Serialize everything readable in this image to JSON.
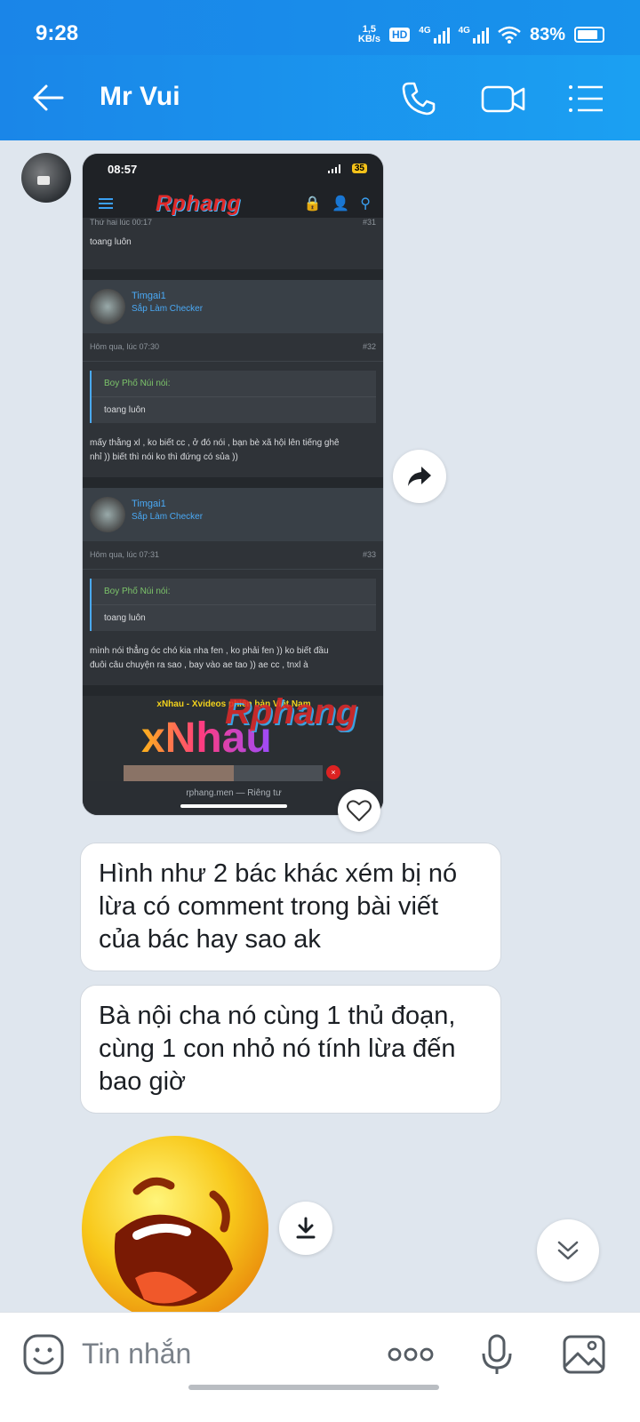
{
  "status_bar": {
    "time": "9:28",
    "net_speed_value": "1,5",
    "net_speed_unit": "KB/s",
    "hd": "HD",
    "sim1": "4G",
    "sim2": "4G",
    "battery": "83%"
  },
  "header": {
    "title": "Mr Vui",
    "icons": [
      "back-arrow-icon",
      "phone-icon",
      "video-camera-icon",
      "menu-list-icon"
    ]
  },
  "screenshot": {
    "time": "08:57",
    "battery": "35",
    "logo": "Rphang",
    "partial_meta": "Thứ hai lúc 00:17",
    "partial_num": "#31",
    "partial_text": "toang luôn",
    "posts": [
      {
        "user": "Timgai1",
        "badge": "Sắp Làm Checker",
        "meta": "Hôm qua, lúc 07:30",
        "num": "#32",
        "quote_author": "Boy Phố Núi nói:",
        "quote_text": "toang luôn",
        "text_line1": "mấy thằng xl , ko biết cc , ở đó nói , bạn bè xã hội lên tiếng ghê",
        "text_line2": "nhỉ )) biết thì nói ko thì đứng có sủa ))"
      },
      {
        "user": "Timgai1",
        "badge": "Sắp Làm Checker",
        "meta": "Hôm qua, lúc 07:31",
        "num": "#33",
        "quote_author": "Boy Phố Núi nói:",
        "quote_text": "toang luôn",
        "text_line1": "mình nói thẳng óc chó kia nha fen , ko phải fen )) ko biết đầu",
        "text_line2": "đuôi câu chuyện ra sao , bay vào ae tao )) ae cc , tnxl à"
      }
    ],
    "ad_title": "xNhau - Xvideos phiên bản Việt Nam",
    "ad_logo": "xNhau",
    "watermark": "Rphang",
    "url": "rphang.men — Riêng tư"
  },
  "messages": [
    {
      "line1": "Hình như 2 bác khác xém bị nó",
      "line2": "lừa có comment trong bài viết",
      "line3": "của bác hay sao ak"
    },
    {
      "line1": "Bà nội cha nó cùng 1 thủ đoạn,",
      "line2": "cùng 1 con nhỏ nó tính lừa đến",
      "line3": "bao giờ"
    }
  ],
  "sticker": "laughing-face-sticker",
  "input": {
    "placeholder": "Tin nhắn"
  },
  "colors": {
    "header": "#1a86e8",
    "chat_bg": "#dfe6ee"
  }
}
